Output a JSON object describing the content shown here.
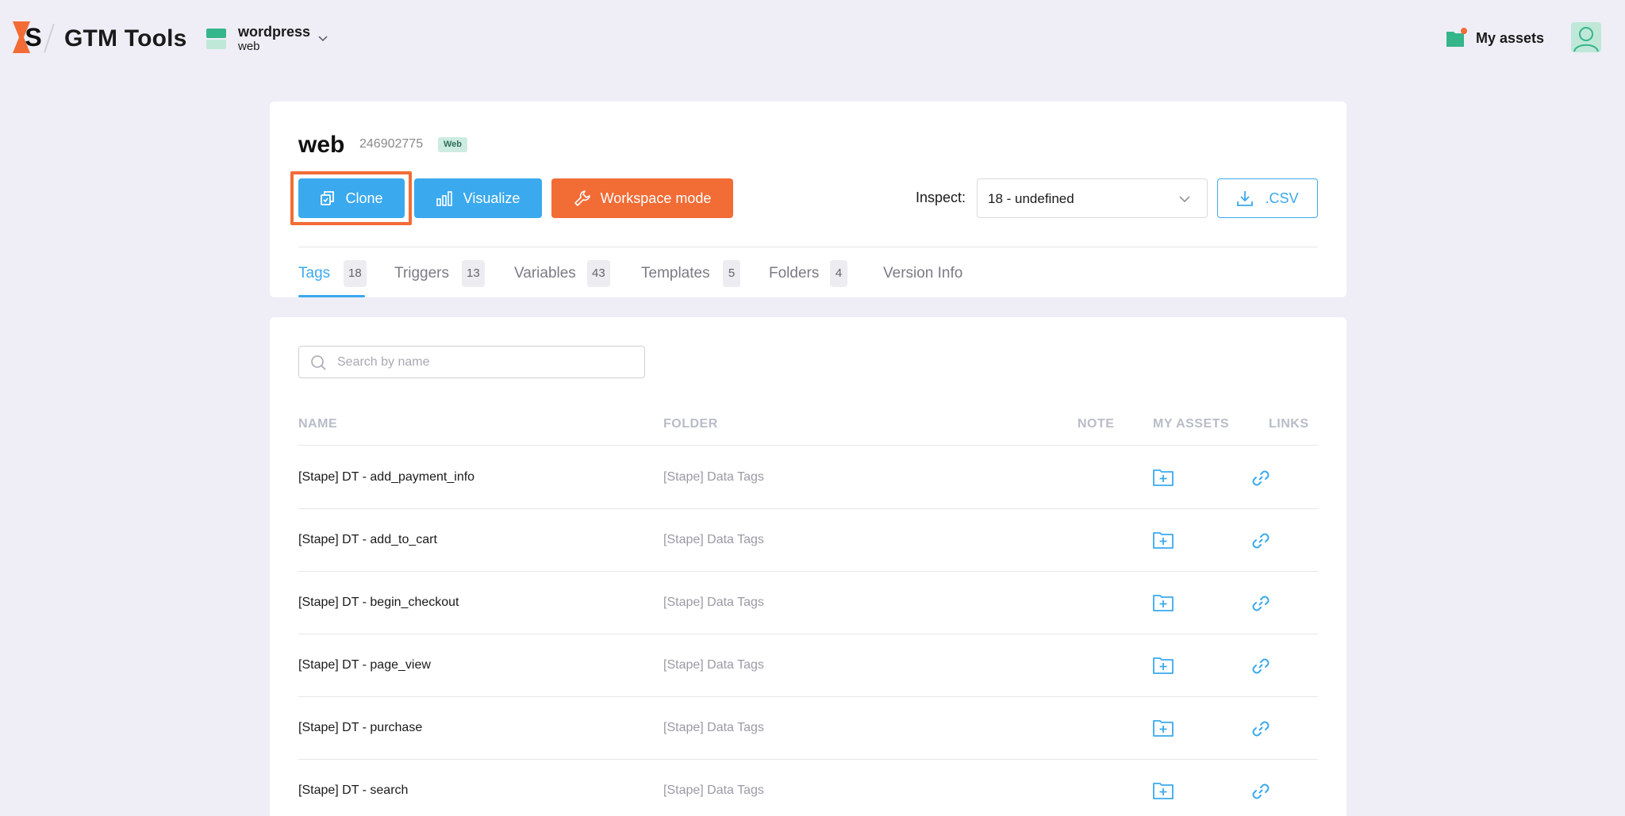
{
  "app": {
    "title": "GTM Tools",
    "container_name": "wordpress",
    "container_sub": "web",
    "my_assets_label": "My assets"
  },
  "header": {
    "title": "web",
    "container_id": "246902775",
    "type_badge": "Web",
    "buttons": {
      "clone": "Clone",
      "visualize": "Visualize",
      "workspace": "Workspace mode",
      "csv": ".CSV"
    },
    "inspect_label": "Inspect:",
    "inspect_value": "18 - undefined",
    "tabs": [
      {
        "label": "Tags",
        "count": "18",
        "active": true
      },
      {
        "label": "Triggers",
        "count": "13"
      },
      {
        "label": "Variables",
        "count": "43"
      },
      {
        "label": "Templates",
        "count": "5"
      },
      {
        "label": "Folders",
        "count": "4"
      },
      {
        "label": "Version Info"
      }
    ]
  },
  "table": {
    "search_placeholder": "Search by name",
    "columns": [
      "NAME",
      "FOLDER",
      "NOTE",
      "MY ASSETS",
      "LINKS"
    ],
    "rows": [
      {
        "name": "[Stape] DT - add_payment_info",
        "folder": "[Stape] Data Tags"
      },
      {
        "name": "[Stape] DT - add_to_cart",
        "folder": "[Stape] Data Tags"
      },
      {
        "name": "[Stape] DT - begin_checkout",
        "folder": "[Stape] Data Tags"
      },
      {
        "name": "[Stape] DT - page_view",
        "folder": "[Stape] Data Tags"
      },
      {
        "name": "[Stape] DT - purchase",
        "folder": "[Stape] Data Tags"
      },
      {
        "name": "[Stape] DT - search",
        "folder": "[Stape] Data Tags"
      }
    ]
  },
  "colors": {
    "accent_blue": "#3aa9ee",
    "accent_orange": "#f26c35",
    "brand_green": "#35b58a",
    "page_bg": "#efeef6"
  },
  "icons": {
    "logo": "stape-logo-icon",
    "container": "container-icon",
    "chevron": "chevron-down-icon",
    "my_assets": "folder-notification-icon",
    "avatar": "user-avatar-icon",
    "clone": "clone-icon",
    "visualize": "bar-chart-icon",
    "workspace": "wrench-icon",
    "csv": "download-icon",
    "search": "search-icon",
    "asset": "folder-plus-icon",
    "link": "link-icon"
  }
}
